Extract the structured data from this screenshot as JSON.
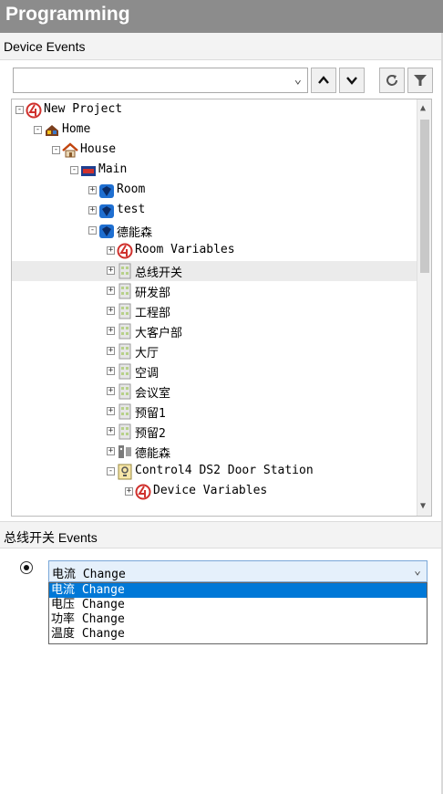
{
  "panel": {
    "title": "Programming"
  },
  "device_events": {
    "header": "Device Events",
    "selector": {
      "value": ""
    },
    "toolbar": {
      "icons": [
        "chevron-up-icon",
        "chevron-down-icon",
        "refresh-icon",
        "filter-icon"
      ]
    },
    "tree": [
      {
        "label": "New Project",
        "icon": "c4-logo-icon",
        "expander": "-",
        "indent": 0
      },
      {
        "label": "Home",
        "icon": "home-icon",
        "expander": "-",
        "indent": 1
      },
      {
        "label": "House",
        "icon": "house-icon",
        "expander": "-",
        "indent": 2
      },
      {
        "label": "Main",
        "icon": "floor-icon",
        "expander": "-",
        "indent": 3
      },
      {
        "label": "Room",
        "icon": "room-icon",
        "expander": "+",
        "indent": 4
      },
      {
        "label": "test",
        "icon": "room-icon",
        "expander": "+",
        "indent": 4
      },
      {
        "label": "德能森",
        "icon": "room-icon",
        "expander": "-",
        "indent": 4
      },
      {
        "label": "Room Variables",
        "icon": "c4-logo-icon",
        "expander": "+",
        "indent": 5
      },
      {
        "label": "总线开关",
        "icon": "device-icon",
        "expander": "+",
        "indent": 5,
        "selected": true
      },
      {
        "label": "研发部",
        "icon": "device-icon",
        "expander": "+",
        "indent": 5
      },
      {
        "label": "工程部",
        "icon": "device-icon",
        "expander": "+",
        "indent": 5
      },
      {
        "label": "大客户部",
        "icon": "device-icon",
        "expander": "+",
        "indent": 5
      },
      {
        "label": "大厅",
        "icon": "device-icon",
        "expander": "+",
        "indent": 5
      },
      {
        "label": "空调",
        "icon": "device-icon",
        "expander": "+",
        "indent": 5
      },
      {
        "label": "会议室",
        "icon": "device-icon",
        "expander": "+",
        "indent": 5
      },
      {
        "label": "预留1",
        "icon": "device-icon",
        "expander": "+",
        "indent": 5
      },
      {
        "label": "预留2",
        "icon": "device-icon",
        "expander": "+",
        "indent": 5
      },
      {
        "label": "德能森",
        "icon": "controller-icon",
        "expander": "+",
        "indent": 5
      },
      {
        "label": "Control4 DS2 Door Station",
        "icon": "door-station-icon",
        "expander": "-",
        "indent": 5
      },
      {
        "label": "Device Variables",
        "icon": "c4-logo-icon",
        "expander": "+",
        "indent": 6
      }
    ]
  },
  "events_section": {
    "header": "总线开关 Events",
    "selected_event": "电流 Change",
    "options": [
      "电流 Change",
      "电压 Change",
      "功率 Change",
      "温度 Change"
    ],
    "highlighted_index": 0
  },
  "colors": {
    "title_bg": "#8c8c8c",
    "highlight": "#0078d7",
    "c4_red": "#d0312d",
    "room_blue": "#1f6fd1"
  }
}
